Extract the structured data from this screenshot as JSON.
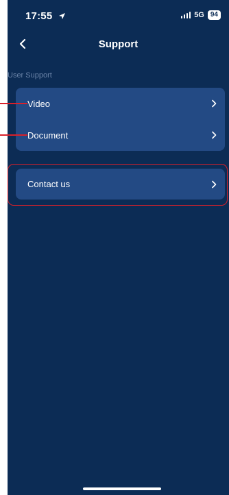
{
  "status_bar": {
    "time": "17:55",
    "network": "5G",
    "battery": "94"
  },
  "nav": {
    "title": "Support"
  },
  "section": {
    "label": "User Support"
  },
  "menu": {
    "items": [
      {
        "label": "Video"
      },
      {
        "label": "Document"
      }
    ],
    "contact": {
      "label": "Contact us"
    }
  },
  "colors": {
    "background": "#0c2c55",
    "card": "#234a84",
    "annotation": "#d9202a"
  }
}
